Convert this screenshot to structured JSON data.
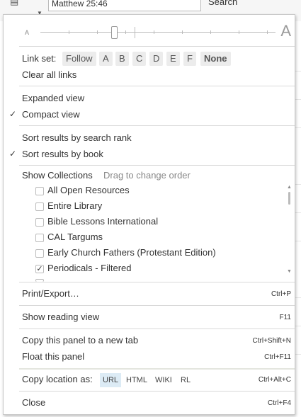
{
  "background": {
    "toolbar_icon": "bible-book-icon",
    "search_value": "Matthew 25:46",
    "search_button": "Search"
  },
  "slider": {
    "small_label": "A",
    "large_label": "A",
    "value_fraction": 0.31
  },
  "link_set": {
    "label": "Link set:",
    "options": [
      "Follow",
      "A",
      "B",
      "C",
      "D",
      "E",
      "F",
      "None"
    ],
    "selected": "None",
    "clear_all": "Clear all links"
  },
  "view": {
    "expanded": "Expanded view",
    "compact": "Compact view",
    "checked": "compact"
  },
  "sort": {
    "by_rank": "Sort results by search rank",
    "by_book": "Sort results by book",
    "checked": "book"
  },
  "collections": {
    "title": "Show Collections",
    "hint": "Drag to change order",
    "items": [
      {
        "label": "All Open Resources",
        "checked": false
      },
      {
        "label": "Entire Library",
        "checked": false
      },
      {
        "label": "Bible Lessons International",
        "checked": false
      },
      {
        "label": "CAL Targums",
        "checked": false
      },
      {
        "label": "Early Church Fathers (Protestant Edition)",
        "checked": false
      },
      {
        "label": "Periodicals - Filtered",
        "checked": true
      }
    ]
  },
  "actions": {
    "print": {
      "label": "Print/Export…",
      "shortcut": "Ctrl+P"
    },
    "reading_view": {
      "label": "Show reading view",
      "shortcut": "F11"
    },
    "copy_panel": {
      "label": "Copy this panel to a new tab",
      "shortcut": "Ctrl+Shift+N"
    },
    "float_panel": {
      "label": "Float this panel",
      "shortcut": "Ctrl+F11"
    },
    "copy_location": {
      "label": "Copy location as:",
      "formats": [
        "URL",
        "HTML",
        "WIKI",
        "RL"
      ],
      "selected": "URL",
      "shortcut": "Ctrl+Alt+C"
    },
    "close": {
      "label": "Close",
      "shortcut": "Ctrl+F4"
    }
  },
  "check_mark": "✓"
}
